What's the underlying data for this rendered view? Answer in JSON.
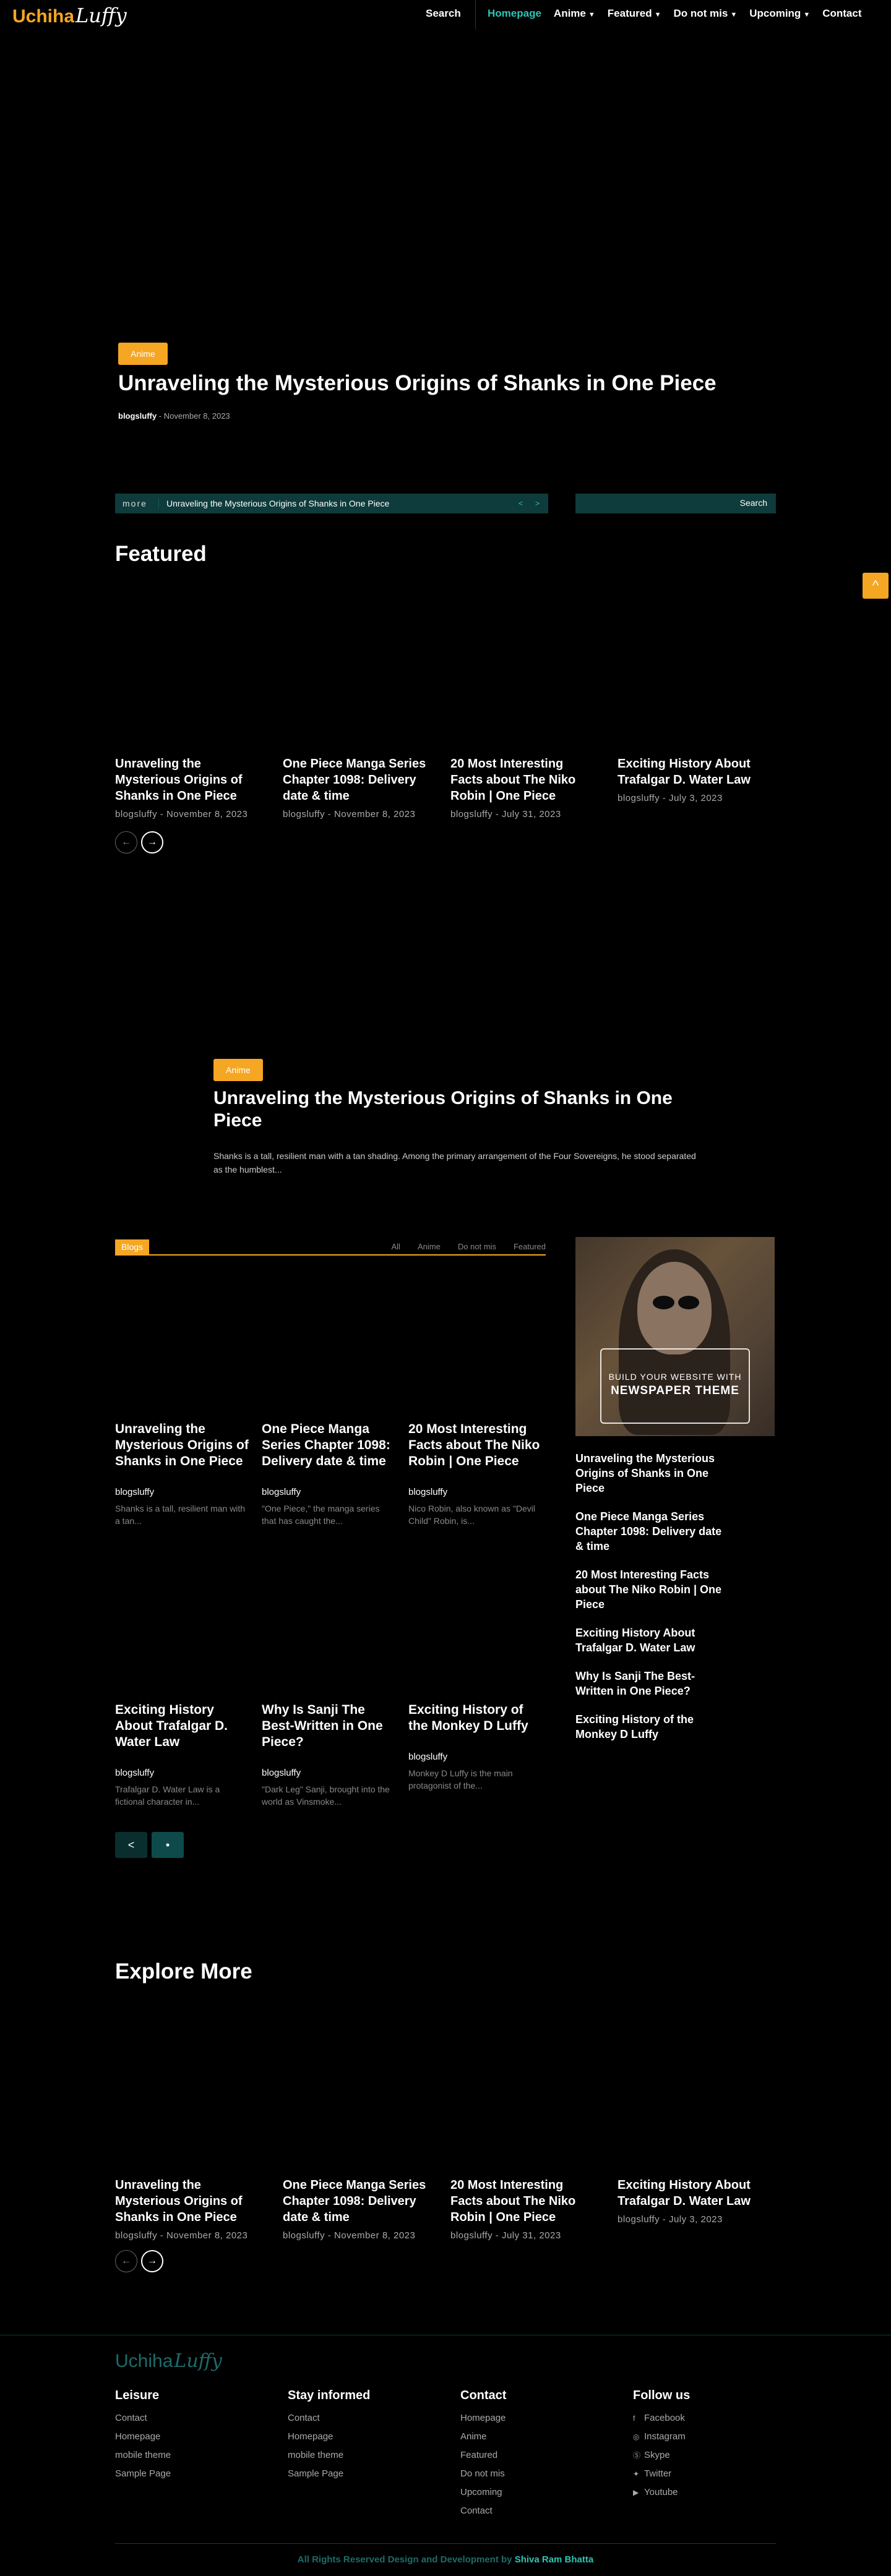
{
  "header": {
    "logo_main": "Uchiha",
    "logo_script": "Luffy",
    "search_label": "Search",
    "nav": [
      {
        "label": "Homepage",
        "active": true,
        "dropdown": false
      },
      {
        "label": "Anime",
        "active": false,
        "dropdown": true
      },
      {
        "label": "Featured",
        "active": false,
        "dropdown": true
      },
      {
        "label": "Do not mis",
        "active": false,
        "dropdown": true
      },
      {
        "label": "Upcoming",
        "active": false,
        "dropdown": true
      },
      {
        "label": "Contact",
        "active": false,
        "dropdown": false
      }
    ]
  },
  "hero": {
    "badge": "Anime",
    "title": "Unraveling the Mysterious Origins of Shanks in One Piece",
    "author": "blogsluffy",
    "separator": "-",
    "date": "November 8, 2023"
  },
  "ticker": {
    "more": "more",
    "text": "Unraveling the Mysterious Origins of Shanks in One Piece",
    "prev": "<",
    "next": ">"
  },
  "search": {
    "button": "Search"
  },
  "scroll_top": "^",
  "featured": {
    "title": "Featured",
    "cards": [
      {
        "title": "Unraveling the Mysterious Origins of Shanks in One Piece",
        "author": "blogsluffy",
        "date": "November 8, 2023"
      },
      {
        "title": "One Piece Manga Series Chapter 1098: Delivery date & time",
        "author": "blogsluffy",
        "date": "November 8, 2023"
      },
      {
        "title": "20 Most Interesting Facts about The Niko Robin | One Piece",
        "author": "blogsluffy",
        "date": "July 31, 2023"
      },
      {
        "title": "Exciting History About Trafalgar D. Water Law",
        "author": "blogsluffy",
        "date": "July 3, 2023"
      }
    ],
    "prev": "←",
    "next": "→"
  },
  "feature_block": {
    "badge": "Anime",
    "title": "Unraveling the Mysterious Origins of Shanks in One Piece",
    "excerpt": "Shanks is a tall, resilient man with a tan shading. Among the primary arrangement of the Four Sovereigns, he stood separated as the humblest..."
  },
  "blogs": {
    "label": "Blogs",
    "tabs": [
      "All",
      "Anime",
      "Do not mis",
      "Featured"
    ],
    "cards": [
      {
        "title": "Unraveling the Mysterious Origins of Shanks in One Piece",
        "author": "blogsluffy",
        "excerpt": "Shanks is a tall, resilient man with a tan..."
      },
      {
        "title": "One Piece Manga Series Chapter 1098: Delivery date & time",
        "author": "blogsluffy",
        "excerpt": "\"One Piece,\" the manga series that has caught the..."
      },
      {
        "title": "20 Most Interesting Facts about The Niko Robin | One Piece",
        "author": "blogsluffy",
        "excerpt": "Nico Robin, also known as \"Devil Child\" Robin, is..."
      },
      {
        "title": "Exciting History About Trafalgar D. Water Law",
        "author": "blogsluffy",
        "excerpt": "Trafalgar D. Water Law is a fictional character in..."
      },
      {
        "title": "Why Is Sanji The Best-Written in One Piece?",
        "author": "blogsluffy",
        "excerpt": "\"Dark Leg\" Sanji, brought into the world as Vinsmoke..."
      },
      {
        "title": "Exciting History of the Monkey D Luffy",
        "author": "blogsluffy",
        "excerpt": "Monkey D Luffy is the main protagonist of the..."
      }
    ],
    "prev": "<",
    "next": "•"
  },
  "sidebar": {
    "promo_line1": "BUILD YOUR WEBSITE WITH",
    "promo_line2": "NEWSPAPER THEME",
    "items": [
      "Unraveling the Mysterious Origins of Shanks in One Piece",
      "One Piece Manga Series Chapter 1098: Delivery date & time",
      "20 Most Interesting Facts about The Niko Robin | One Piece",
      "Exciting History About Trafalgar D. Water Law",
      "Why Is Sanji The Best-Written in One Piece?",
      "Exciting History of the Monkey D Luffy"
    ]
  },
  "explore": {
    "title": "Explore More",
    "cards": [
      {
        "title": "Unraveling the Mysterious Origins of Shanks in One Piece",
        "author": "blogsluffy",
        "date": "November 8, 2023"
      },
      {
        "title": "One Piece Manga Series Chapter 1098: Delivery date & time",
        "author": "blogsluffy",
        "date": "November 8, 2023"
      },
      {
        "title": "20 Most Interesting Facts about The Niko Robin | One Piece",
        "author": "blogsluffy",
        "date": "July 31, 2023"
      },
      {
        "title": "Exciting History About Trafalgar D. Water Law",
        "author": "blogsluffy",
        "date": "July 3, 2023"
      }
    ],
    "prev": "←",
    "next": "→"
  },
  "footer": {
    "logo_main": "Uchiha",
    "logo_script": "Luffy",
    "columns": [
      {
        "head": "Leisure",
        "links": [
          "Contact",
          "Homepage",
          "mobile theme",
          "Sample Page"
        ]
      },
      {
        "head": "Stay informed",
        "links": [
          "Contact",
          "Homepage",
          "mobile theme",
          "Sample Page"
        ]
      },
      {
        "head": "Contact",
        "links": [
          "Homepage",
          "Anime",
          "Featured",
          "Do not mis",
          "Upcoming",
          "Contact"
        ]
      },
      {
        "head": "Follow us",
        "links": [
          "Facebook",
          "Instagram",
          "Skype",
          "Twitter",
          "Youtube"
        ]
      }
    ],
    "social_icons": [
      "facebook-icon",
      "instagram-icon",
      "skype-icon",
      "twitter-icon",
      "youtube-icon"
    ],
    "copyright": "All Rights Reserved Design and Development by",
    "copyright_author": "Shiva Ram Bhatta"
  },
  "colors": {
    "accent": "#f5a623",
    "teal": "#2ec4b6",
    "dark_teal": "#0e3b3b"
  }
}
